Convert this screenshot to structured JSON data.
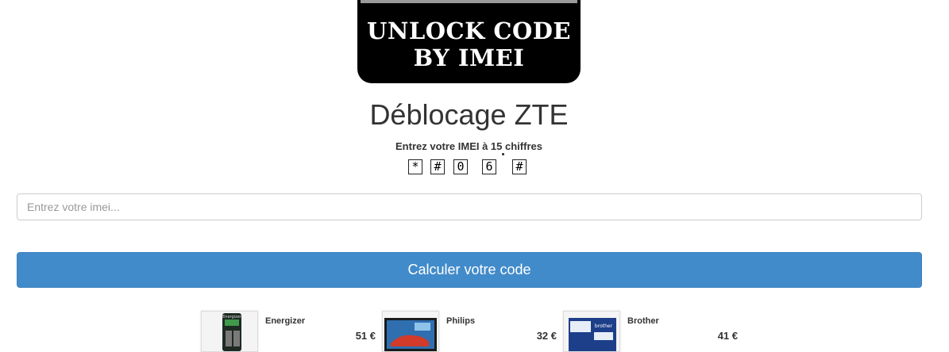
{
  "logo": {
    "line1": "UNLOCK CODE",
    "line2": "BY IMEI"
  },
  "page_title": "Déblocage ZTE",
  "hint": "Entrez votre IMEI à 15 chiffres",
  "keys": [
    "*",
    "#",
    "0",
    "6",
    "#"
  ],
  "imei_input": {
    "placeholder": "Entrez votre imei...",
    "value": ""
  },
  "submit_label": "Calculer votre code",
  "products": [
    {
      "brand": "Energizer",
      "price": "51 €",
      "image_icon": "charger-product-image"
    },
    {
      "brand": "Philips",
      "price": "32 €",
      "image_icon": "monitor-product-image"
    },
    {
      "brand": "Brother",
      "price": "41 €",
      "image_icon": "printer-box-product-image"
    }
  ]
}
